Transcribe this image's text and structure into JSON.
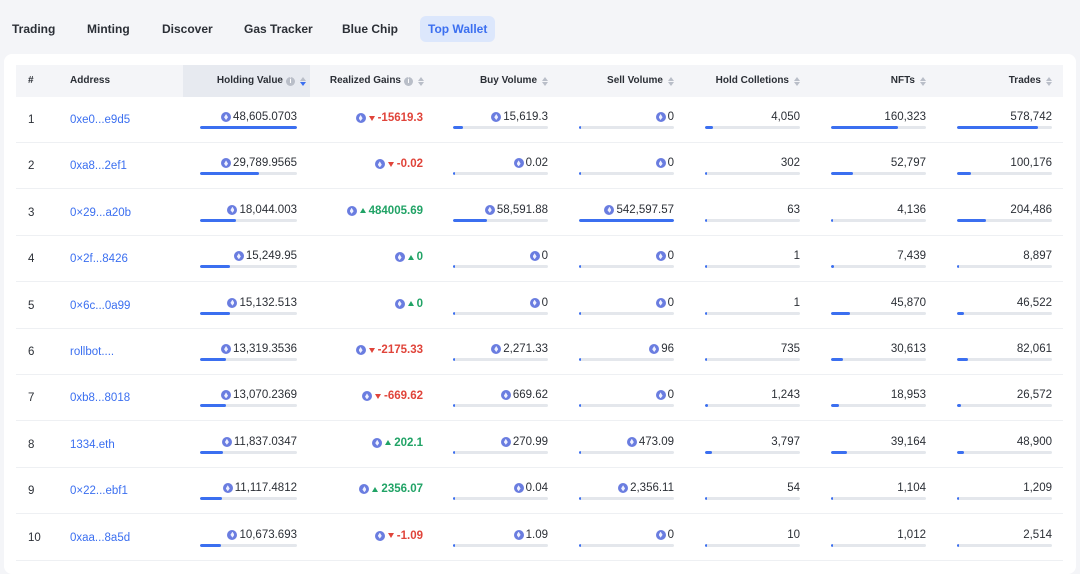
{
  "tabs": [
    {
      "label": "Trading",
      "active": false
    },
    {
      "label": "Minting",
      "active": false
    },
    {
      "label": "Discover",
      "active": false
    },
    {
      "label": "Gas Tracker",
      "active": false
    },
    {
      "label": "Blue Chip",
      "active": false
    },
    {
      "label": "Top Wallet",
      "active": true
    }
  ],
  "table": {
    "headers": {
      "index": "#",
      "address": "Address",
      "holding_value": "Holding Value",
      "realized_gains": "Realized Gains",
      "buy_volume": "Buy Volume",
      "sell_volume": "Sell Volume",
      "hold_collections": "Hold Colletions",
      "nfts": "NFTs",
      "trades": "Trades"
    },
    "sorted_column": "holding_value",
    "sort_direction": "desc",
    "rows": [
      {
        "index": "1",
        "address": "0xe0...e9d5",
        "holding_value": "48,605.0703",
        "holding_bar": 1.0,
        "gains": "-15619.3",
        "gains_dir": "down",
        "buy_volume": "15,619.3",
        "buy_bar": 0.1,
        "sell_volume": "0",
        "sell_bar": 0,
        "hold_collections": "4,050",
        "collections_bar": 0.08,
        "nfts": "160,323",
        "nfts_bar": 0.7,
        "trades": "578,742",
        "trades_bar": 0.85
      },
      {
        "index": "2",
        "address": "0xa8...2ef1",
        "holding_value": "29,789.9565",
        "holding_bar": 0.61,
        "gains": "-0.02",
        "gains_dir": "down",
        "buy_volume": "0.02",
        "buy_bar": 0,
        "sell_volume": "0",
        "sell_bar": 0,
        "hold_collections": "302",
        "collections_bar": 0.01,
        "nfts": "52,797",
        "nfts_bar": 0.23,
        "trades": "100,176",
        "trades_bar": 0.15
      },
      {
        "index": "3",
        "address": "0×29...a20b",
        "holding_value": "18,044.003",
        "holding_bar": 0.37,
        "gains": "484005.69",
        "gains_dir": "up",
        "buy_volume": "58,591.88",
        "buy_bar": 0.36,
        "sell_volume": "542,597.57",
        "sell_bar": 1.0,
        "hold_collections": "63",
        "collections_bar": 0,
        "nfts": "4,136",
        "nfts_bar": 0.02,
        "trades": "204,486",
        "trades_bar": 0.3
      },
      {
        "index": "4",
        "address": "0×2f...8426",
        "holding_value": "15,249.95",
        "holding_bar": 0.31,
        "gains": "0",
        "gains_dir": "up",
        "buy_volume": "0",
        "buy_bar": 0,
        "sell_volume": "0",
        "sell_bar": 0,
        "hold_collections": "1",
        "collections_bar": 0,
        "nfts": "7,439",
        "nfts_bar": 0.03,
        "trades": "8,897",
        "trades_bar": 0.02
      },
      {
        "index": "5",
        "address": "0×6c...0a99",
        "holding_value": "15,132.513",
        "holding_bar": 0.31,
        "gains": "0",
        "gains_dir": "up",
        "buy_volume": "0",
        "buy_bar": 0,
        "sell_volume": "0",
        "sell_bar": 0,
        "hold_collections": "1",
        "collections_bar": 0,
        "nfts": "45,870",
        "nfts_bar": 0.2,
        "trades": "46,522",
        "trades_bar": 0.07
      },
      {
        "index": "6",
        "address": "rollbot....",
        "holding_value": "13,319.3536",
        "holding_bar": 0.27,
        "gains": "-2175.33",
        "gains_dir": "down",
        "buy_volume": "2,271.33",
        "buy_bar": 0.01,
        "sell_volume": "96",
        "sell_bar": 0,
        "hold_collections": "735",
        "collections_bar": 0.02,
        "nfts": "30,613",
        "nfts_bar": 0.13,
        "trades": "82,061",
        "trades_bar": 0.12
      },
      {
        "index": "7",
        "address": "0xb8...8018",
        "holding_value": "13,070.2369",
        "holding_bar": 0.27,
        "gains": "-669.62",
        "gains_dir": "down",
        "buy_volume": "669.62",
        "buy_bar": 0,
        "sell_volume": "0",
        "sell_bar": 0,
        "hold_collections": "1,243",
        "collections_bar": 0.03,
        "nfts": "18,953",
        "nfts_bar": 0.08,
        "trades": "26,572",
        "trades_bar": 0.04
      },
      {
        "index": "8",
        "address": "1334.eth",
        "holding_value": "11,837.0347",
        "holding_bar": 0.24,
        "gains": "202.1",
        "gains_dir": "up",
        "buy_volume": "270.99",
        "buy_bar": 0,
        "sell_volume": "473.09",
        "sell_bar": 0,
        "hold_collections": "3,797",
        "collections_bar": 0.07,
        "nfts": "39,164",
        "nfts_bar": 0.17,
        "trades": "48,900",
        "trades_bar": 0.07
      },
      {
        "index": "9",
        "address": "0×22...ebf1",
        "holding_value": "11,117.4812",
        "holding_bar": 0.23,
        "gains": "2356.07",
        "gains_dir": "up",
        "buy_volume": "0.04",
        "buy_bar": 0,
        "sell_volume": "2,356.11",
        "sell_bar": 0.01,
        "hold_collections": "54",
        "collections_bar": 0,
        "nfts": "1,104",
        "nfts_bar": 0.01,
        "trades": "1,209",
        "trades_bar": 0
      },
      {
        "index": "10",
        "address": "0xaa...8a5d",
        "holding_value": "10,673.693",
        "holding_bar": 0.22,
        "gains": "-1.09",
        "gains_dir": "down",
        "buy_volume": "1.09",
        "buy_bar": 0,
        "sell_volume": "0",
        "sell_bar": 0,
        "hold_collections": "10",
        "collections_bar": 0,
        "nfts": "1,012",
        "nfts_bar": 0,
        "trades": "2,514",
        "trades_bar": 0
      }
    ]
  },
  "colors": {
    "accent": "#3b6ff0",
    "negative": "#e0443a",
    "positive": "#21a366"
  },
  "icons": {
    "currency": "eth-icon",
    "info": "info-icon",
    "sort": "sort-icon"
  }
}
